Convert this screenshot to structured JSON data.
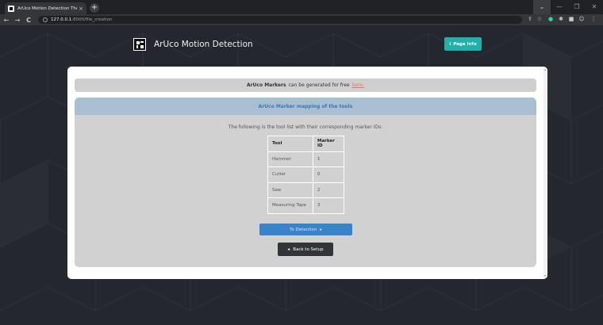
{
  "browser": {
    "tab_title": "ArUco Motion Detection Thesis",
    "tab_close": "×",
    "new_tab": "+",
    "nav_back": "←",
    "nav_forward": "→",
    "nav_reload": "C",
    "url_host": "127.0.0.1",
    "url_path": ":8000/file_creation",
    "window_controls": [
      "⌄",
      "—",
      "❐",
      "✕"
    ]
  },
  "header": {
    "brand_text": "ArUco Motion Detection",
    "page_info_label": "Page Info",
    "page_info_icon": "i"
  },
  "notice": {
    "bold": "ArUco Markers",
    "text": "can be generated for free",
    "link": "here."
  },
  "panel": {
    "title": "ArUco Marker mapping of the tools",
    "description": "The following is the tool list with their corresponding marker IDs:",
    "table": {
      "headers": [
        "Tool",
        "Marker ID"
      ],
      "rows": [
        [
          "Hammer",
          "1"
        ],
        [
          "Cutter",
          "0"
        ],
        [
          "Saw",
          "2"
        ],
        [
          "Measuring Tape",
          "3"
        ]
      ]
    },
    "detect_button": "To Detection",
    "detect_arrow": "▸",
    "back_button": "Back to Setup",
    "back_arrow": "◂"
  },
  "colors": {
    "accent_teal": "#20b2aa",
    "primary_blue": "#3a83c8",
    "panel_header": "#a9bed0",
    "link": "#e8746c"
  }
}
